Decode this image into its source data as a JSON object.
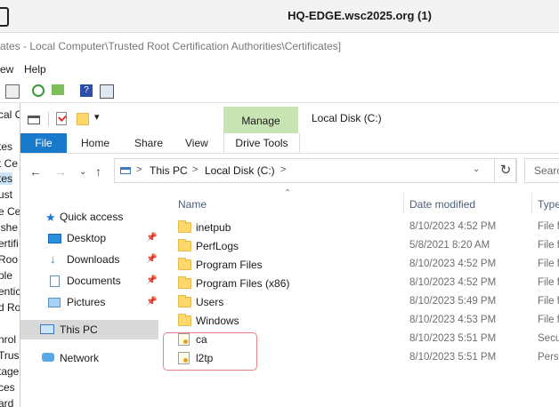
{
  "rdp": {
    "title": "HQ-EDGE.wsc2025.org (1)"
  },
  "mmc": {
    "title": "ates - Local Computer\\Trusted Root Certification Authorities\\Certificates]",
    "menu": [
      "ew",
      "Help"
    ],
    "tree_fragments": [
      "cal C",
      "tes",
      "t Ce",
      "tes",
      "ust",
      "e Ce",
      "ishe",
      "ertifi",
      "Roo",
      "ple",
      "entic",
      "d Ro",
      "nrol",
      "Trus",
      "tage",
      "ces",
      "ard"
    ]
  },
  "explorer": {
    "qat_dropdown": "▾",
    "manage_tab": "Manage",
    "window_title": "Local Disk (C:)",
    "ribbon_tabs": [
      "File",
      "Home",
      "Share",
      "View",
      "Drive Tools"
    ],
    "address": {
      "crumbs": [
        "This PC",
        "Local Disk (C:)"
      ],
      "sep": ">"
    },
    "search_placeholder": "Searc",
    "nav": {
      "quick_access": "Quick access",
      "items": [
        "Desktop",
        "Downloads",
        "Documents",
        "Pictures"
      ],
      "this_pc": "This PC",
      "network": "Network"
    },
    "columns": {
      "name": "Name",
      "date": "Date modified",
      "type": "Type"
    },
    "files": [
      {
        "name": "inetpub",
        "date": "8/10/2023 4:52 PM",
        "type": "File f",
        "kind": "folder"
      },
      {
        "name": "PerfLogs",
        "date": "5/8/2021 8:20 AM",
        "type": "File f",
        "kind": "folder"
      },
      {
        "name": "Program Files",
        "date": "8/10/2023 4:52 PM",
        "type": "File f",
        "kind": "folder"
      },
      {
        "name": "Program Files (x86)",
        "date": "8/10/2023 4:52 PM",
        "type": "File f",
        "kind": "folder"
      },
      {
        "name": "Users",
        "date": "8/10/2023 5:49 PM",
        "type": "File f",
        "kind": "folder"
      },
      {
        "name": "Windows",
        "date": "8/10/2023 4:53 PM",
        "type": "File f",
        "kind": "folder"
      },
      {
        "name": "ca",
        "date": "8/10/2023 5:51 PM",
        "type": "Secu",
        "kind": "cert"
      },
      {
        "name": "l2tp",
        "date": "8/10/2023 5:51 PM",
        "type": "Perso",
        "kind": "cert"
      }
    ]
  },
  "colors": {
    "file_tab": "#1979ca",
    "manage_tab": "#c9e4b4",
    "highlight": "#e8808a"
  }
}
